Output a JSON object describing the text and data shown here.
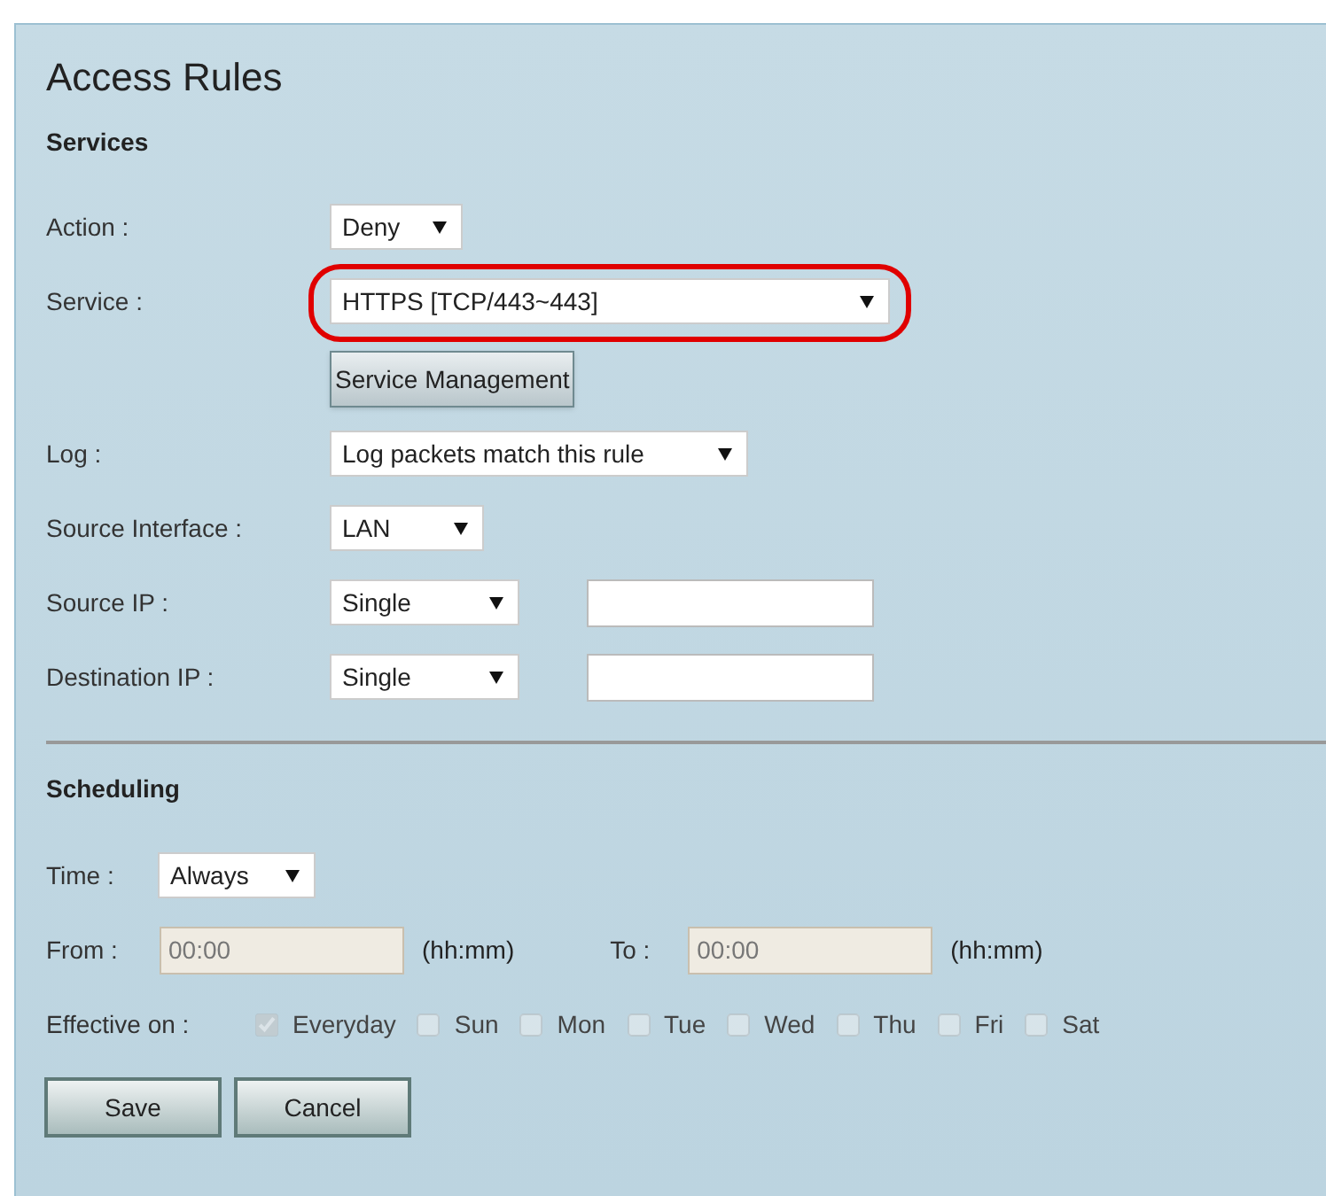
{
  "title": "Access Rules",
  "services": {
    "heading": "Services",
    "action": {
      "label": "Action :",
      "value": "Deny"
    },
    "service": {
      "label": "Service :",
      "value": "HTTPS [TCP/443~443]",
      "highlighted": true
    },
    "service_management_button": "Service Management",
    "log": {
      "label": "Log :",
      "value": "Log packets match this rule"
    },
    "source_interface": {
      "label": "Source Interface :",
      "value": "LAN"
    },
    "source_ip": {
      "label": "Source IP :",
      "value": "Single"
    },
    "destination_ip": {
      "label": "Destination IP :",
      "value": "Single"
    }
  },
  "scheduling": {
    "heading": "Scheduling",
    "time": {
      "label": "Time :",
      "value": "Always"
    },
    "from": {
      "label": "From :",
      "value": "00:00",
      "unit": "(hh:mm)",
      "disabled": true
    },
    "to": {
      "label": "To :",
      "value": "00:00",
      "unit": "(hh:mm)",
      "disabled": true
    },
    "effective_on": {
      "label": "Effective on :",
      "days": [
        {
          "label": "Everyday",
          "checked": true,
          "disabled": true
        },
        {
          "label": "Sun",
          "checked": false,
          "disabled": true
        },
        {
          "label": "Mon",
          "checked": false,
          "disabled": true
        },
        {
          "label": "Tue",
          "checked": false,
          "disabled": true
        },
        {
          "label": "Wed",
          "checked": false,
          "disabled": true
        },
        {
          "label": "Thu",
          "checked": false,
          "disabled": true
        },
        {
          "label": "Fri",
          "checked": false,
          "disabled": true
        },
        {
          "label": "Sat",
          "checked": false,
          "disabled": true
        }
      ]
    }
  },
  "buttons": [
    "Save",
    "Cancel"
  ]
}
